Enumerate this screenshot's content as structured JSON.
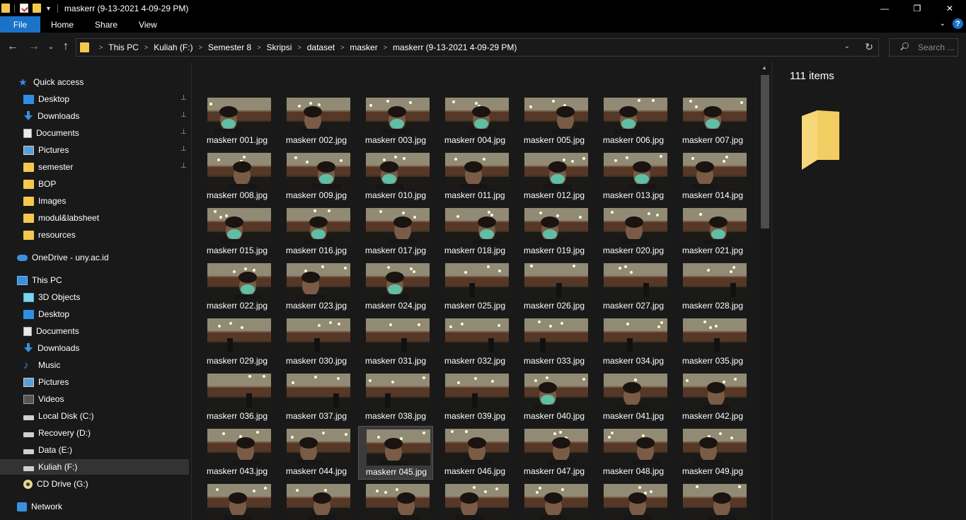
{
  "window": {
    "title": "maskerr (9-13-2021 4-09-29 PM)",
    "minimize_glyph": "—",
    "maximize_glyph": "❐",
    "close_glyph": "✕"
  },
  "ribbon": {
    "tabs": [
      {
        "label": "File"
      },
      {
        "label": "Home"
      },
      {
        "label": "Share"
      },
      {
        "label": "View"
      }
    ],
    "expand_glyph": "⌄",
    "help_glyph": "?"
  },
  "nav": {
    "back_glyph": "←",
    "forward_glyph": "→",
    "recent_glyph": "⌄",
    "up_glyph": "↑"
  },
  "address": {
    "crumbs": [
      "This PC",
      "Kuliah (F:)",
      "Semester 8",
      "Skripsi",
      "dataset",
      "masker",
      "maskerr (9-13-2021 4-09-29 PM)"
    ],
    "dropdown_glyph": "⌄",
    "refresh_glyph": "↻"
  },
  "search": {
    "placeholder": "Search ..."
  },
  "sidebar": {
    "quick_access": {
      "label": "Quick access",
      "items": [
        {
          "label": "Desktop",
          "icon": "desktop-icon",
          "pinned": true
        },
        {
          "label": "Downloads",
          "icon": "downloads-icon",
          "pinned": true
        },
        {
          "label": "Documents",
          "icon": "documents-icon",
          "pinned": true
        },
        {
          "label": "Pictures",
          "icon": "pictures-icon",
          "pinned": true
        },
        {
          "label": "semester",
          "icon": "folder-icon",
          "pinned": true
        },
        {
          "label": "BOP",
          "icon": "folder-icon",
          "pinned": false
        },
        {
          "label": "Images",
          "icon": "folder-icon",
          "pinned": false
        },
        {
          "label": "modul&labsheet",
          "icon": "folder-icon",
          "pinned": false
        },
        {
          "label": "resources",
          "icon": "folder-icon",
          "pinned": false
        }
      ]
    },
    "onedrive": {
      "label": "OneDrive - uny.ac.id"
    },
    "this_pc": {
      "label": "This PC",
      "items": [
        {
          "label": "3D Objects",
          "icon": "3d-objects-icon"
        },
        {
          "label": "Desktop",
          "icon": "desktop-icon"
        },
        {
          "label": "Documents",
          "icon": "documents-icon"
        },
        {
          "label": "Downloads",
          "icon": "downloads-icon"
        },
        {
          "label": "Music",
          "icon": "music-icon"
        },
        {
          "label": "Pictures",
          "icon": "pictures-icon"
        },
        {
          "label": "Videos",
          "icon": "videos-icon"
        },
        {
          "label": "Local Disk (C:)",
          "icon": "drive-icon"
        },
        {
          "label": "Recovery (D:)",
          "icon": "drive-icon"
        },
        {
          "label": "Data (E:)",
          "icon": "drive-icon"
        },
        {
          "label": "Kuliah (F:)",
          "icon": "drive-icon",
          "selected": true
        },
        {
          "label": "CD Drive (G:)",
          "icon": "cd-drive-icon"
        }
      ]
    },
    "network": {
      "label": "Network"
    },
    "pin_glyph": "📌"
  },
  "files": [
    "maskerr 001.jpg",
    "maskerr 002.jpg",
    "maskerr 003.jpg",
    "maskerr 004.jpg",
    "maskerr 005.jpg",
    "maskerr 006.jpg",
    "maskerr 007.jpg",
    "maskerr 008.jpg",
    "maskerr 009.jpg",
    "maskerr 010.jpg",
    "maskerr 011.jpg",
    "maskerr 012.jpg",
    "maskerr 013.jpg",
    "maskerr 014.jpg",
    "maskerr 015.jpg",
    "maskerr 016.jpg",
    "maskerr 017.jpg",
    "maskerr 018.jpg",
    "maskerr 019.jpg",
    "maskerr 020.jpg",
    "maskerr 021.jpg",
    "maskerr 022.jpg",
    "maskerr 023.jpg",
    "maskerr 024.jpg",
    "maskerr 025.jpg",
    "maskerr 026.jpg",
    "maskerr 027.jpg",
    "maskerr 028.jpg",
    "maskerr 029.jpg",
    "maskerr 030.jpg",
    "maskerr 031.jpg",
    "maskerr 032.jpg",
    "maskerr 033.jpg",
    "maskerr 034.jpg",
    "maskerr 035.jpg",
    "maskerr 036.jpg",
    "maskerr 037.jpg",
    "maskerr 038.jpg",
    "maskerr 039.jpg",
    "maskerr 040.jpg",
    "maskerr 041.jpg",
    "maskerr 042.jpg",
    "maskerr 043.jpg",
    "maskerr 044.jpg",
    "maskerr 045.jpg",
    "maskerr 046.jpg",
    "maskerr 047.jpg",
    "maskerr 048.jpg",
    "maskerr 049.jpg"
  ],
  "partial_row_count": 7,
  "selected_file": "maskerr 045.jpg",
  "details": {
    "item_count": "111 items"
  },
  "colors": {
    "background": "#191919",
    "accent": "#1a73c9",
    "folder": "#f4c84f",
    "mask": "#5fbfa5"
  }
}
